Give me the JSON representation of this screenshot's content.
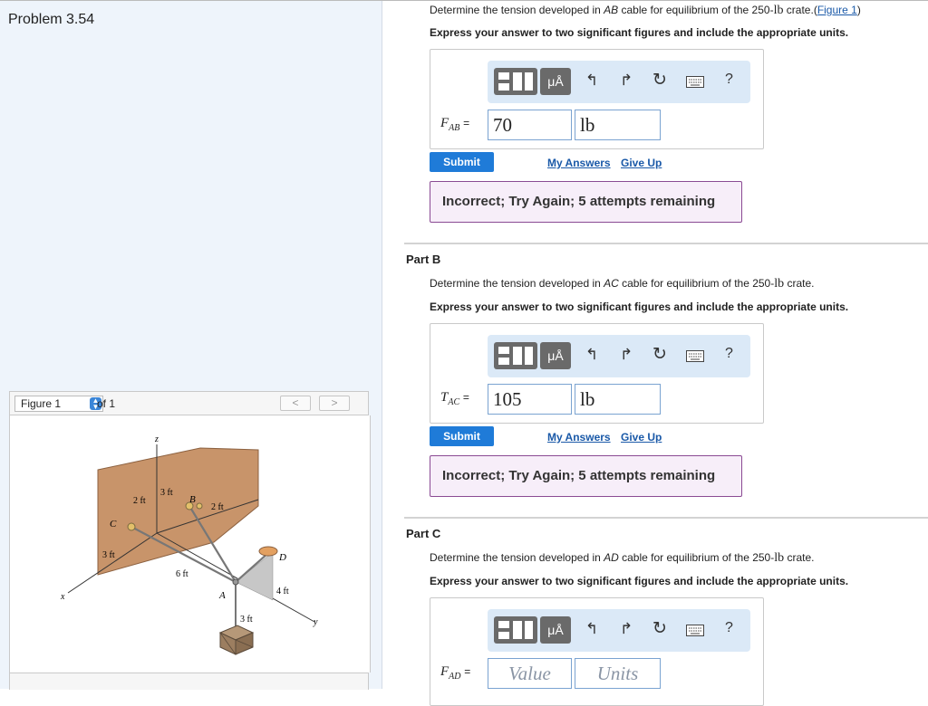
{
  "problem": {
    "title": "Problem 3.54"
  },
  "figure": {
    "selector_value": "Figure 1",
    "of_label": "of 1",
    "prev": "<",
    "next": ">",
    "labels": {
      "z": "z",
      "x": "x",
      "y": "y",
      "c": "C",
      "b": "B",
      "a": "A",
      "d": "D",
      "d2ft_a": "2 ft",
      "d3ft_a": "3 ft",
      "d2ft_b": "2 ft",
      "d3ft_wall": "3 ft",
      "d6ft": "6 ft",
      "d4ft": "4 ft",
      "d3ft_bottom": "3 ft"
    }
  },
  "toolbar": {
    "mu": "μÅ",
    "undo": "↰",
    "redo": "↱",
    "reset": "↻",
    "help": "?"
  },
  "partA": {
    "q_prefix": "Determine the tension developed in ",
    "q_cable": "AB",
    "q_suffix": " cable for equilibrium of the 250-",
    "q_unit": "lb",
    "q_end": " crate.(",
    "figure_link": "Figure 1",
    "q_close": ")",
    "instr": "Express your answer to two significant figures and include the appropriate units.",
    "var_main": "F",
    "var_sub": "AB",
    "eq": "=",
    "value": "70",
    "unit": "lb",
    "submit": "Submit",
    "my_answers": "My Answers",
    "give_up": "Give Up",
    "feedback": "Incorrect; Try Again; 5 attempts remaining"
  },
  "partB": {
    "label": "Part B",
    "q_prefix": "Determine the tension developed in ",
    "q_cable": "AC",
    "q_suffix": " cable for equilibrium of the 250-",
    "q_unit": "lb",
    "q_end": " crate.",
    "instr": "Express your answer to two significant figures and include the appropriate units.",
    "var_main": "T",
    "var_sub": "AC",
    "eq": "=",
    "value": "105",
    "unit": "lb",
    "submit": "Submit",
    "my_answers": "My Answers",
    "give_up": "Give Up",
    "feedback": "Incorrect; Try Again; 5 attempts remaining"
  },
  "partC": {
    "label": "Part C",
    "q_prefix": "Determine the tension developed in ",
    "q_cable": "AD",
    "q_suffix": " cable for equilibrium of the 250-",
    "q_unit": "lb",
    "q_end": " crate.",
    "instr": "Express your answer to two significant figures and include the appropriate units.",
    "var_main": "F",
    "var_sub": "AD",
    "eq": "=",
    "value_placeholder": "Value",
    "unit_placeholder": "Units"
  }
}
